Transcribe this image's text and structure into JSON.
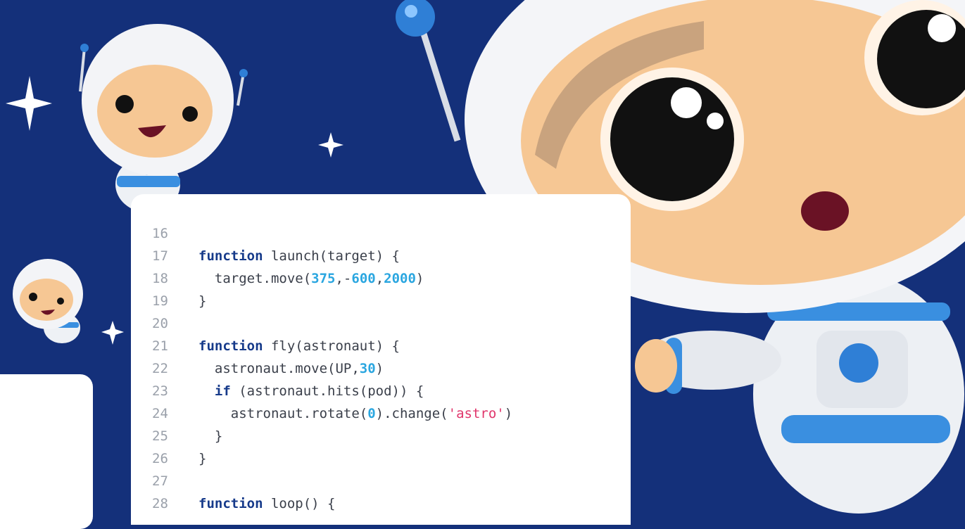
{
  "code": {
    "lines": [
      {
        "num": "16",
        "tokens": []
      },
      {
        "num": "17",
        "tokens": [
          {
            "t": "function",
            "c": "kw"
          },
          {
            "t": " launch(target) {",
            "c": ""
          }
        ]
      },
      {
        "num": "18",
        "tokens": [
          {
            "t": "  target.move(",
            "c": ""
          },
          {
            "t": "375",
            "c": "num"
          },
          {
            "t": ",-",
            "c": ""
          },
          {
            "t": "600",
            "c": "num"
          },
          {
            "t": ",",
            "c": ""
          },
          {
            "t": "2000",
            "c": "num"
          },
          {
            "t": ")",
            "c": ""
          }
        ]
      },
      {
        "num": "19",
        "tokens": [
          {
            "t": "}",
            "c": ""
          }
        ]
      },
      {
        "num": "20",
        "tokens": []
      },
      {
        "num": "21",
        "tokens": [
          {
            "t": "function",
            "c": "kw"
          },
          {
            "t": " fly(astronaut) {",
            "c": ""
          }
        ]
      },
      {
        "num": "22",
        "tokens": [
          {
            "t": "  astronaut.move(UP,",
            "c": ""
          },
          {
            "t": "30",
            "c": "num"
          },
          {
            "t": ")",
            "c": ""
          }
        ]
      },
      {
        "num": "23",
        "tokens": [
          {
            "t": "  ",
            "c": ""
          },
          {
            "t": "if",
            "c": "kw"
          },
          {
            "t": " (astronaut.hits(pod)) {",
            "c": ""
          }
        ]
      },
      {
        "num": "24",
        "tokens": [
          {
            "t": "    astronaut.rotate(",
            "c": ""
          },
          {
            "t": "0",
            "c": "num"
          },
          {
            "t": ").change(",
            "c": ""
          },
          {
            "t": "'astro'",
            "c": "str"
          },
          {
            "t": ")",
            "c": ""
          }
        ]
      },
      {
        "num": "25",
        "tokens": [
          {
            "t": "  }",
            "c": ""
          }
        ]
      },
      {
        "num": "26",
        "tokens": [
          {
            "t": "}",
            "c": ""
          }
        ]
      },
      {
        "num": "27",
        "tokens": []
      },
      {
        "num": "28",
        "tokens": [
          {
            "t": "function",
            "c": "kw"
          },
          {
            "t": " loop() {",
            "c": ""
          }
        ]
      }
    ]
  },
  "colors": {
    "background": "#14307a",
    "keyword": "#163a8a",
    "number": "#2aa6e0",
    "string": "#e0356b"
  },
  "icons": {
    "decor": [
      "astronaut-large-icon",
      "astronaut-small-icon",
      "astronaut-tiny-icon",
      "sparkle-icon"
    ]
  }
}
